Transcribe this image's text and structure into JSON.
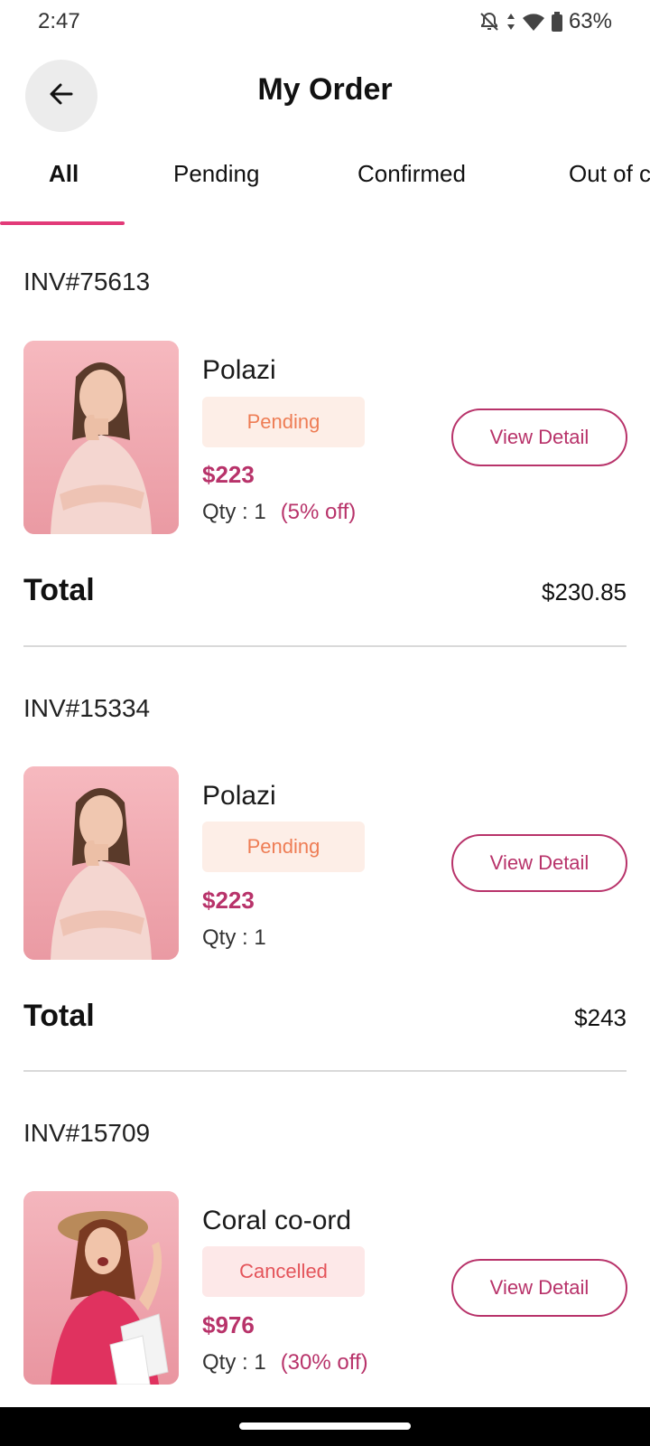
{
  "status_bar": {
    "time": "2:47",
    "battery": "63%",
    "icons": [
      "bell-off-icon",
      "data-arrows-icon",
      "wifi-icon",
      "battery-icon"
    ]
  },
  "header": {
    "title": "My Order",
    "back_icon": "arrow-left-icon"
  },
  "tabs": [
    {
      "label": "All",
      "active": true
    },
    {
      "label": "Pending",
      "active": false
    },
    {
      "label": "Confirmed",
      "active": false
    },
    {
      "label": "Out of c",
      "active": false
    }
  ],
  "orders": [
    {
      "invoice": "INV#75613",
      "product": "Polazi",
      "status": "Pending",
      "price": "$223",
      "qty": "Qty : 1",
      "discount": "(5% off)",
      "button": "View Detail",
      "total_label": "Total",
      "total": "$230.85"
    },
    {
      "invoice": "INV#15334",
      "product": "Polazi",
      "status": "Pending",
      "price": "$223",
      "qty": "Qty : 1",
      "discount": "",
      "button": "View Detail",
      "total_label": "Total",
      "total": "$243"
    },
    {
      "invoice": "INV#15709",
      "product": "Coral co-ord",
      "status": "Cancelled",
      "price": "$976",
      "qty": "Qty : 1",
      "discount": "(30% off)",
      "button": "View Detail"
    }
  ],
  "colors": {
    "accent": "#e23a78",
    "price": "#b8336a",
    "pending_text": "#ee7d55",
    "pending_bg": "#fdeee7",
    "cancelled_text": "#e4545a",
    "cancelled_bg": "#fde8e8"
  }
}
